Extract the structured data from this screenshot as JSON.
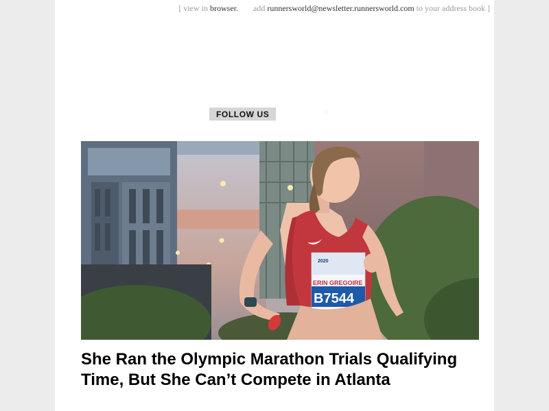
{
  "preheader": {
    "open_bracket": "[",
    "view_in": "view in",
    "browser_link": "browser.",
    "add": "add",
    "email_link": "runnersworld@newsletter.runnersworld.com",
    "address_book": "to your address book",
    "close_bracket": "]"
  },
  "social": {
    "follow_label": "FOLLOW US"
  },
  "hero": {
    "bib_name": "ERIN GREGOIRE",
    "bib_number": "B7544",
    "bib_year": "2020"
  },
  "article": {
    "headline": "She Ran the Olympic Marathon Trials Qualifying Time, But She Can’t Compete in Atlanta"
  }
}
